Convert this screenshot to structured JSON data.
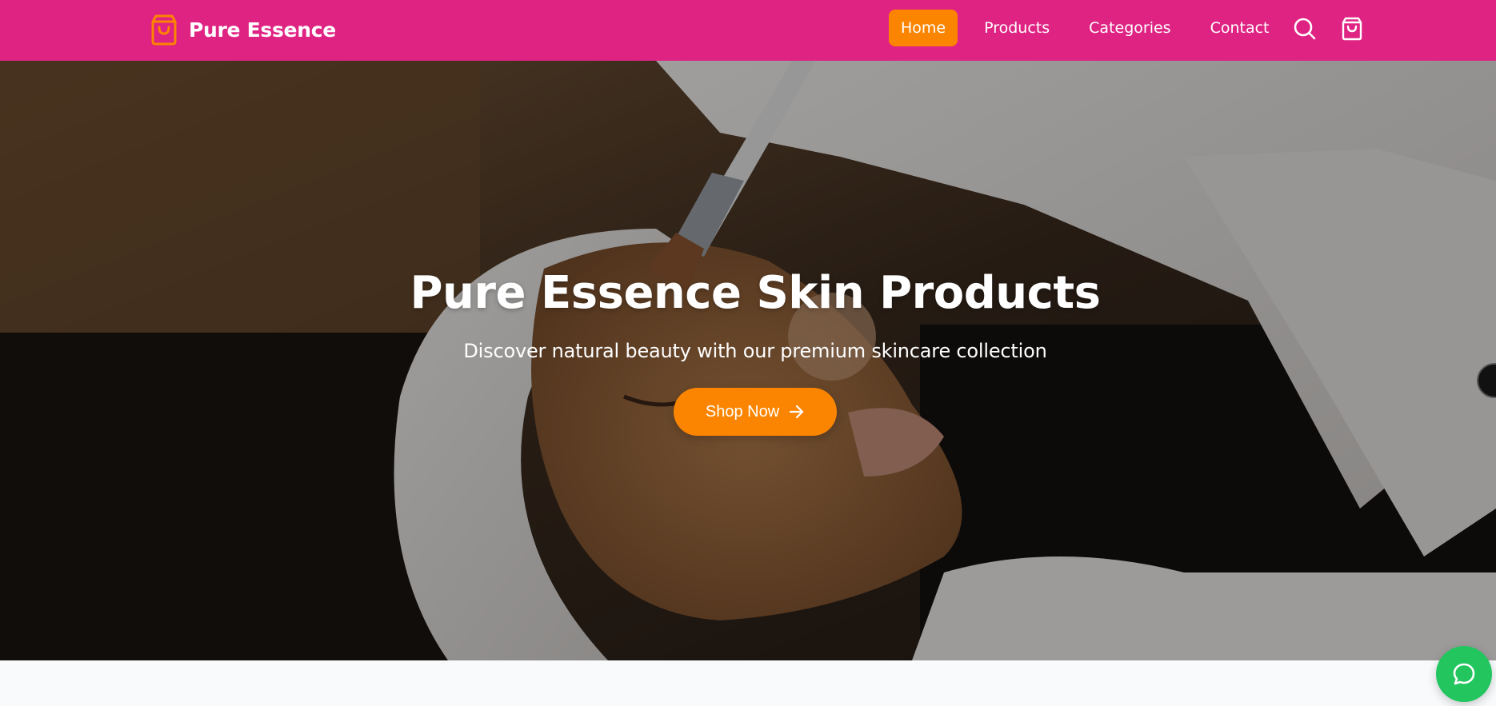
{
  "brand": {
    "name": "Pure Essence",
    "icon": "shopping-bag-icon"
  },
  "nav": {
    "items": [
      {
        "label": "Home",
        "active": true
      },
      {
        "label": "Products",
        "active": false
      },
      {
        "label": "Categories",
        "active": false
      },
      {
        "label": "Contact",
        "active": false
      }
    ],
    "search_icon": "search-icon",
    "cart_icon": "cart-icon"
  },
  "hero": {
    "title": "Pure Essence Skin Products",
    "subtitle": "Discover natural beauty with our premium skincare collection",
    "cta_label": "Shop Now",
    "cta_icon": "arrow-right-icon"
  },
  "chat": {
    "icon": "chat-bubble-icon"
  },
  "colors": {
    "header_bg": "#df2383",
    "accent": "#fb8500",
    "chat_bg": "#22c55e",
    "text_light": "#ffffff"
  }
}
